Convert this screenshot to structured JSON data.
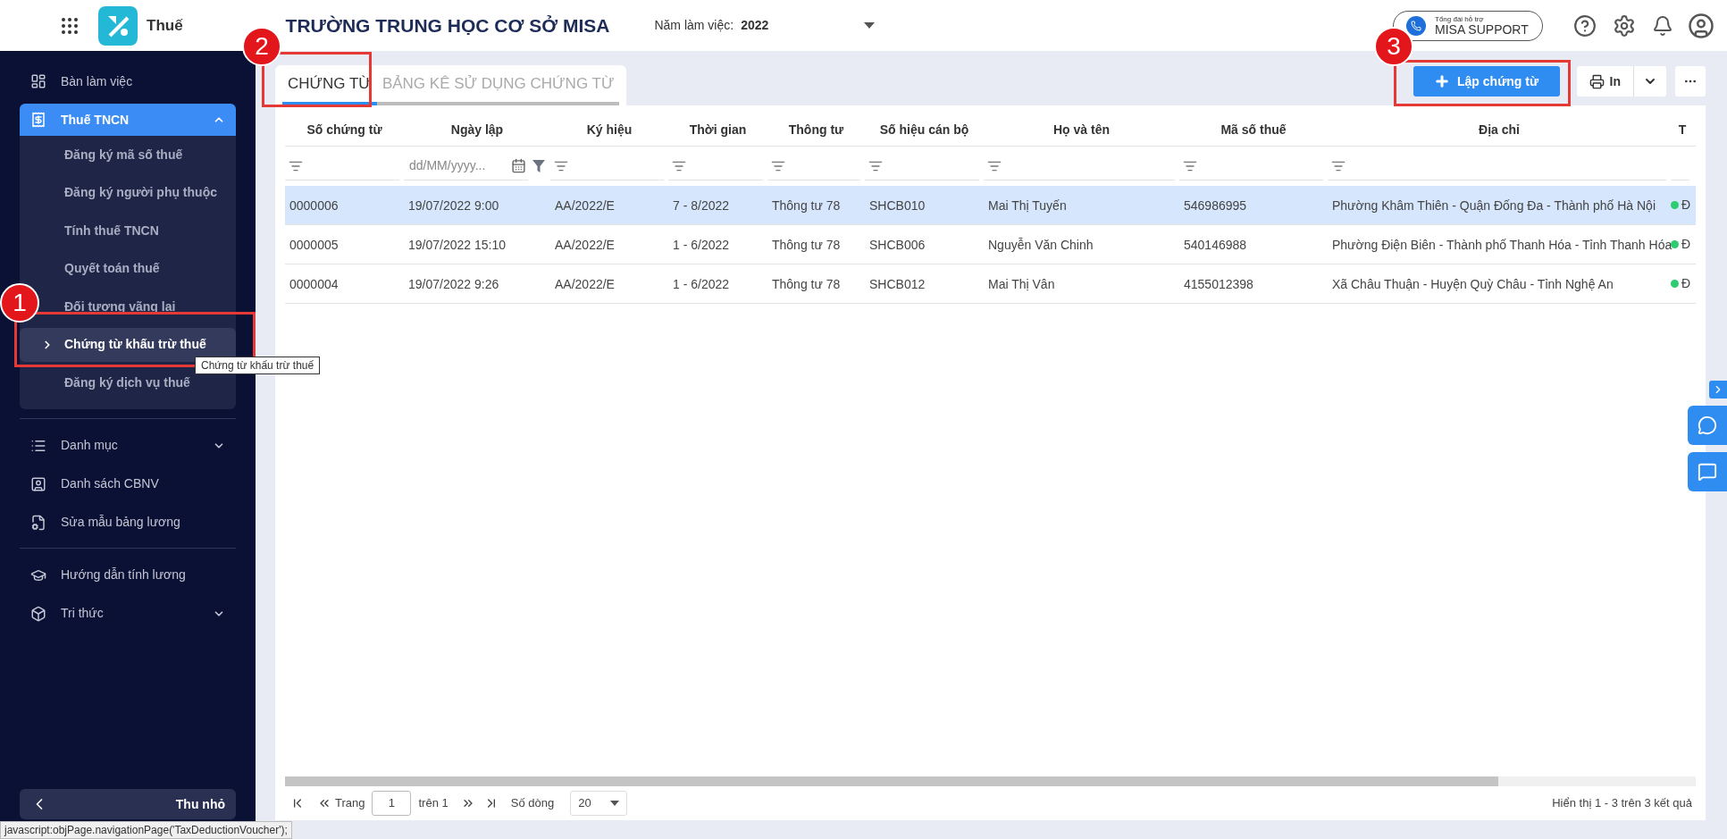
{
  "app": {
    "name": "Thuế"
  },
  "header": {
    "school": "TRƯỜNG TRUNG HỌC CƠ SỞ MISA",
    "year_label": "Năm làm việc:",
    "year": "2022",
    "support": {
      "caption": "Tổng đài hỗ trợ",
      "label": "MISA SUPPORT"
    }
  },
  "sidebar": {
    "sections": [
      [
        {
          "label": "Bàn làm việc",
          "selected": false
        },
        {
          "label": "Thuế TNCN",
          "selected": true,
          "expanded": true,
          "children": [
            {
              "label": "Đăng ký mã số thuế",
              "selected": false
            },
            {
              "label": "Đăng ký người phụ thuộc",
              "selected": false
            },
            {
              "label": "Tính thuế TNCN",
              "selected": false
            },
            {
              "label": "Quyết toán thuế",
              "selected": false
            },
            {
              "label": "Đối tượng vãng lai",
              "selected": false
            },
            {
              "label": "Chứng từ khấu trừ thuế",
              "selected": true
            },
            {
              "label": "Đăng ký dịch vụ thuế",
              "selected": false
            }
          ]
        }
      ],
      [
        {
          "label": "Danh mục",
          "selected": false,
          "expanded": false
        },
        {
          "label": "Danh sách CBNV",
          "selected": false
        },
        {
          "label": "Sửa mẫu bảng lương",
          "selected": false
        }
      ],
      [
        {
          "label": "Hướng dẫn tính lương",
          "selected": false
        },
        {
          "label": "Tri thức",
          "selected": false,
          "expanded": false
        }
      ]
    ],
    "collapse": "Thu nhỏ"
  },
  "tooltip": "Chứng từ khấu trừ thuế",
  "tabs": [
    {
      "label": "CHỨNG TỪ",
      "selected": true
    },
    {
      "label": "BẢNG KÊ SỬ DỤNG CHỨNG TỪ",
      "selected": false
    }
  ],
  "toolbar": {
    "create": "Lập chứng từ",
    "print": "In"
  },
  "table": {
    "columns": [
      {
        "label": "Số chứng từ",
        "kind": "text"
      },
      {
        "label": "Ngày lập",
        "kind": "date",
        "placeholder": "dd/MM/yyyy..."
      },
      {
        "label": "Ký hiệu",
        "kind": "text"
      },
      {
        "label": "Thời gian",
        "kind": "text"
      },
      {
        "label": "Thông tư",
        "kind": "text"
      },
      {
        "label": "Số hiệu cán bộ",
        "kind": "text"
      },
      {
        "label": "Họ và tên",
        "kind": "text"
      },
      {
        "label": "Mã số thuế",
        "kind": "text"
      },
      {
        "label": "Địa chỉ",
        "kind": "text"
      },
      {
        "label": "T",
        "kind": "plain"
      }
    ],
    "rows": [
      {
        "selected": true,
        "cells": [
          "0000006",
          "19/07/2022 9:00",
          "AA/2022/E",
          "7 - 8/2022",
          "Thông tư 78",
          "SHCB010",
          "Mai Thị Tuyến",
          "546986995",
          "Phường Khâm Thiên - Quận Đống Đa - Thành phố Hà Nội"
        ],
        "status": {
          "color": "#2ecc71",
          "text": "Đ"
        }
      },
      {
        "selected": false,
        "cells": [
          "0000005",
          "19/07/2022 15:10",
          "AA/2022/E",
          "1 - 6/2022",
          "Thông tư 78",
          "SHCB006",
          "Nguyễn Văn Chinh",
          "540146988",
          "Phường Điện Biên - Thành phố Thanh Hóa - Tỉnh Thanh Hóa"
        ],
        "status": {
          "color": "#2ecc71",
          "text": "Đ"
        }
      },
      {
        "selected": false,
        "cells": [
          "0000004",
          "19/07/2022 9:26",
          "AA/2022/E",
          "1 - 6/2022",
          "Thông tư 78",
          "SHCB012",
          "Mai Thị Vân",
          "4155012398",
          "Xã Châu Thuận - Huyện Quỳ Châu - Tỉnh Nghệ An"
        ],
        "status": {
          "color": "#2ecc71",
          "text": "Đ"
        }
      }
    ]
  },
  "pagination": {
    "page_label": "Trang",
    "page": "1",
    "of": "trên 1",
    "rows_label": "Số dòng",
    "rows": "20",
    "summary": "Hiển thị 1 - 3 trên 3 kết quả"
  },
  "annotations": [
    {
      "number": "1"
    },
    {
      "number": "2"
    },
    {
      "number": "3"
    }
  ],
  "status_url": "javascript:objPage.navigationPage('TaxDeductionVoucher');"
}
